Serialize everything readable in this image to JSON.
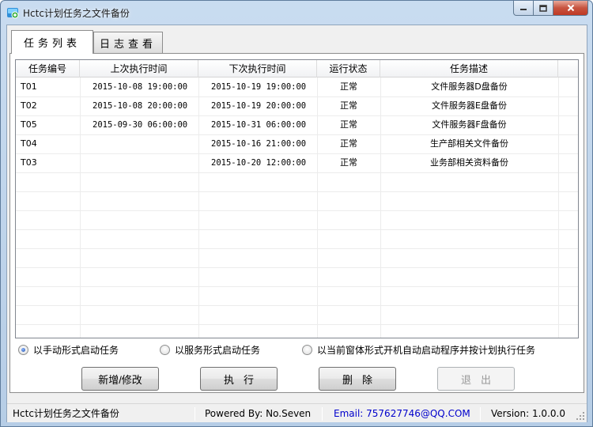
{
  "window": {
    "title": "Hctc计划任务之文件备份"
  },
  "tabs": [
    {
      "label": "任务列表"
    },
    {
      "label": "日志查看"
    }
  ],
  "table": {
    "columns": [
      "任务编号",
      "上次执行时间",
      "下次执行时间",
      "运行状态",
      "任务描述"
    ],
    "rows": [
      [
        "T01",
        "2015-10-08 19:00:00",
        "2015-10-19 19:00:00",
        "正常",
        "文件服务器D盘备份"
      ],
      [
        "T02",
        "2015-10-08 20:00:00",
        "2015-10-19 20:00:00",
        "正常",
        "文件服务器E盘备份"
      ],
      [
        "T05",
        "2015-09-30 06:00:00",
        "2015-10-31 06:00:00",
        "正常",
        "文件服务器F盘备份"
      ],
      [
        "T04",
        "",
        "2015-10-16 21:00:00",
        "正常",
        "生产部相关文件备份"
      ],
      [
        "T03",
        "",
        "2015-10-20 12:00:00",
        "正常",
        "业务部相关资料备份"
      ]
    ]
  },
  "options": {
    "selected_index": 0,
    "items": [
      "以手动形式启动任务",
      "以服务形式启动任务",
      "以当前窗体形式开机自动启动程序并按计划执行任务"
    ]
  },
  "buttons": {
    "add_edit": "新增/修改",
    "run": "执行",
    "delete": "删除",
    "exit": "退出"
  },
  "status": {
    "app": "Hctc计划任务之文件备份",
    "powered": "Powered By: No.Seven",
    "email": "Email: 757627746@QQ.COM",
    "version": "Version: 1.0.0.0"
  },
  "colors": {
    "email": "#0000cc",
    "accent": "#3a6ea5"
  }
}
